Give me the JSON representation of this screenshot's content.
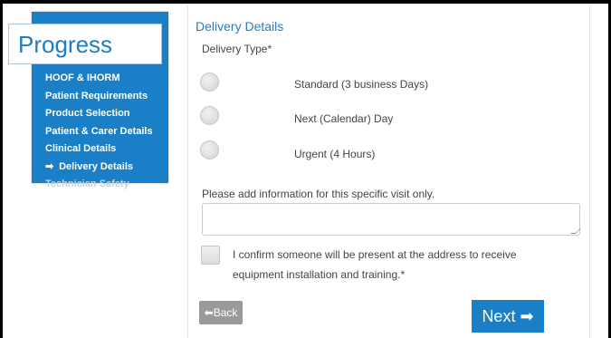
{
  "progress": {
    "title": "Progress",
    "steps": [
      {
        "label": "HOOF & IHORM",
        "state": "done"
      },
      {
        "label": "Patient Requirements",
        "state": "done"
      },
      {
        "label": "Product Selection",
        "state": "done"
      },
      {
        "label": "Patient & Carer Details",
        "state": "done"
      },
      {
        "label": "Clinical Details",
        "state": "done"
      },
      {
        "label": "Delivery Details",
        "state": "current",
        "icon": "arrow-right-icon"
      },
      {
        "label": "Technician Safety",
        "state": "pending"
      }
    ],
    "colors": {
      "panel": "#1a7fc6",
      "pending_text": "#b9d6ee"
    }
  },
  "form": {
    "section_title": "Delivery Details",
    "delivery_type_label": "Delivery Type*",
    "delivery_options": [
      {
        "label": "Standard (3 business Days)",
        "selected": false
      },
      {
        "label": "Next (Calendar) Day",
        "selected": false
      },
      {
        "label": "Urgent (4 Hours)",
        "selected": false
      }
    ],
    "info_label": "Please add information for this specific visit only.",
    "info_value": "",
    "confirm_text": "I confirm someone will be present at the address to receive equipment installation and training.*",
    "confirm_checked": false
  },
  "buttons": {
    "back_label": "Back",
    "back_icon": "arrow-left-icon",
    "next_label": "Next",
    "next_icon": "arrow-right-icon"
  }
}
